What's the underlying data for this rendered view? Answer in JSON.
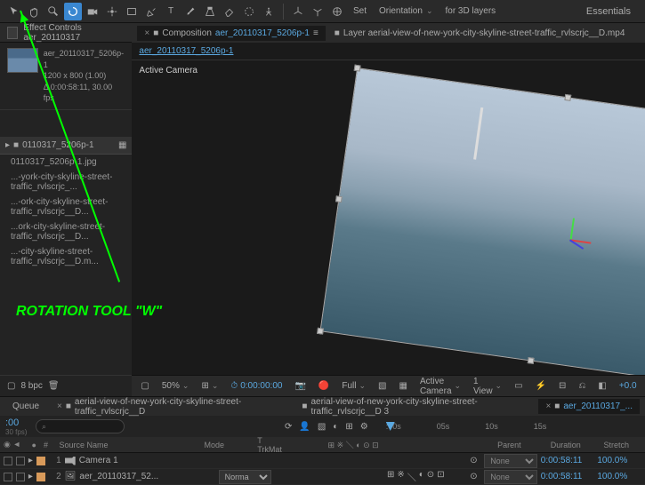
{
  "toolbar": {
    "set_label": "Set",
    "orientation_label": "Orientation",
    "for3d_label": "for 3D layers",
    "workspace": "Essentials"
  },
  "effectControls": {
    "tab_label": "Effect Controls aer_20110317",
    "item_name": "aer_20110317_5206p-1",
    "dimensions": "1200 x 800 (1.00)",
    "duration": "Δ 0:00:58:11, 30.00 fps"
  },
  "project": {
    "comp_name": "0110317_5206p-1",
    "items": [
      "0110317_5206p-1.jpg",
      "...-york-city-skyline-street-traffic_rvlscrjc_...",
      "...-ork-city-skyline-street-traffic_rvlscrjc__D...",
      "...ork-city-skyline-street-traffic_rvlscrjc__D...",
      "...-city-skyline-street-traffic_rvlscrjc__D.m..."
    ],
    "bpc": "8 bpc"
  },
  "composition": {
    "tab_prefix": "Composition",
    "tab_name": "aer_20110317_5206p-1",
    "layer_tab": "Layer aerial-view-of-new-york-city-skyline-street-traffic_rvlscrjc__D.mp4",
    "breadcrumb": "aer_20110317_5206p-1",
    "viewer_label": "Active Camera"
  },
  "viewerFooter": {
    "zoom": "50%",
    "time": "0:00:00:00",
    "quality": "Full",
    "camera": "Active Camera",
    "views": "1 View",
    "exposure": "+0.0"
  },
  "timelineTabs": {
    "queue": "Queue",
    "tab1": "aerial-view-of-new-york-city-skyline-street-traffic_rvlscrjc__D",
    "tab2": "aerial-view-of-new-york-city-skyline-street-traffic_rvlscrjc__D 3",
    "tab3": "aer_20110317_..."
  },
  "timeline": {
    "current_time": ":00",
    "fps_hint": "30 fps)",
    "ruler": [
      ":00s",
      "05s",
      "10s",
      "15s"
    ],
    "columns": {
      "num": "#",
      "name": "Source Name",
      "mode": "Mode",
      "trk": "T  TrkMat",
      "parent": "Parent",
      "duration": "Duration",
      "stretch": "Stretch"
    },
    "layers": [
      {
        "num": "1",
        "name": "Camera 1",
        "color": "#d89a5a",
        "mode": "",
        "parent": "None",
        "duration": "0:00:58:11",
        "stretch": "100.0%"
      },
      {
        "num": "2",
        "name": "aer_20110317_52...",
        "color": "#d89a5a",
        "mode": "Norma",
        "parent": "None",
        "duration": "0:00:58:11",
        "stretch": "100.0%"
      }
    ]
  },
  "annotation": "ROTATION TOOL \"W\""
}
